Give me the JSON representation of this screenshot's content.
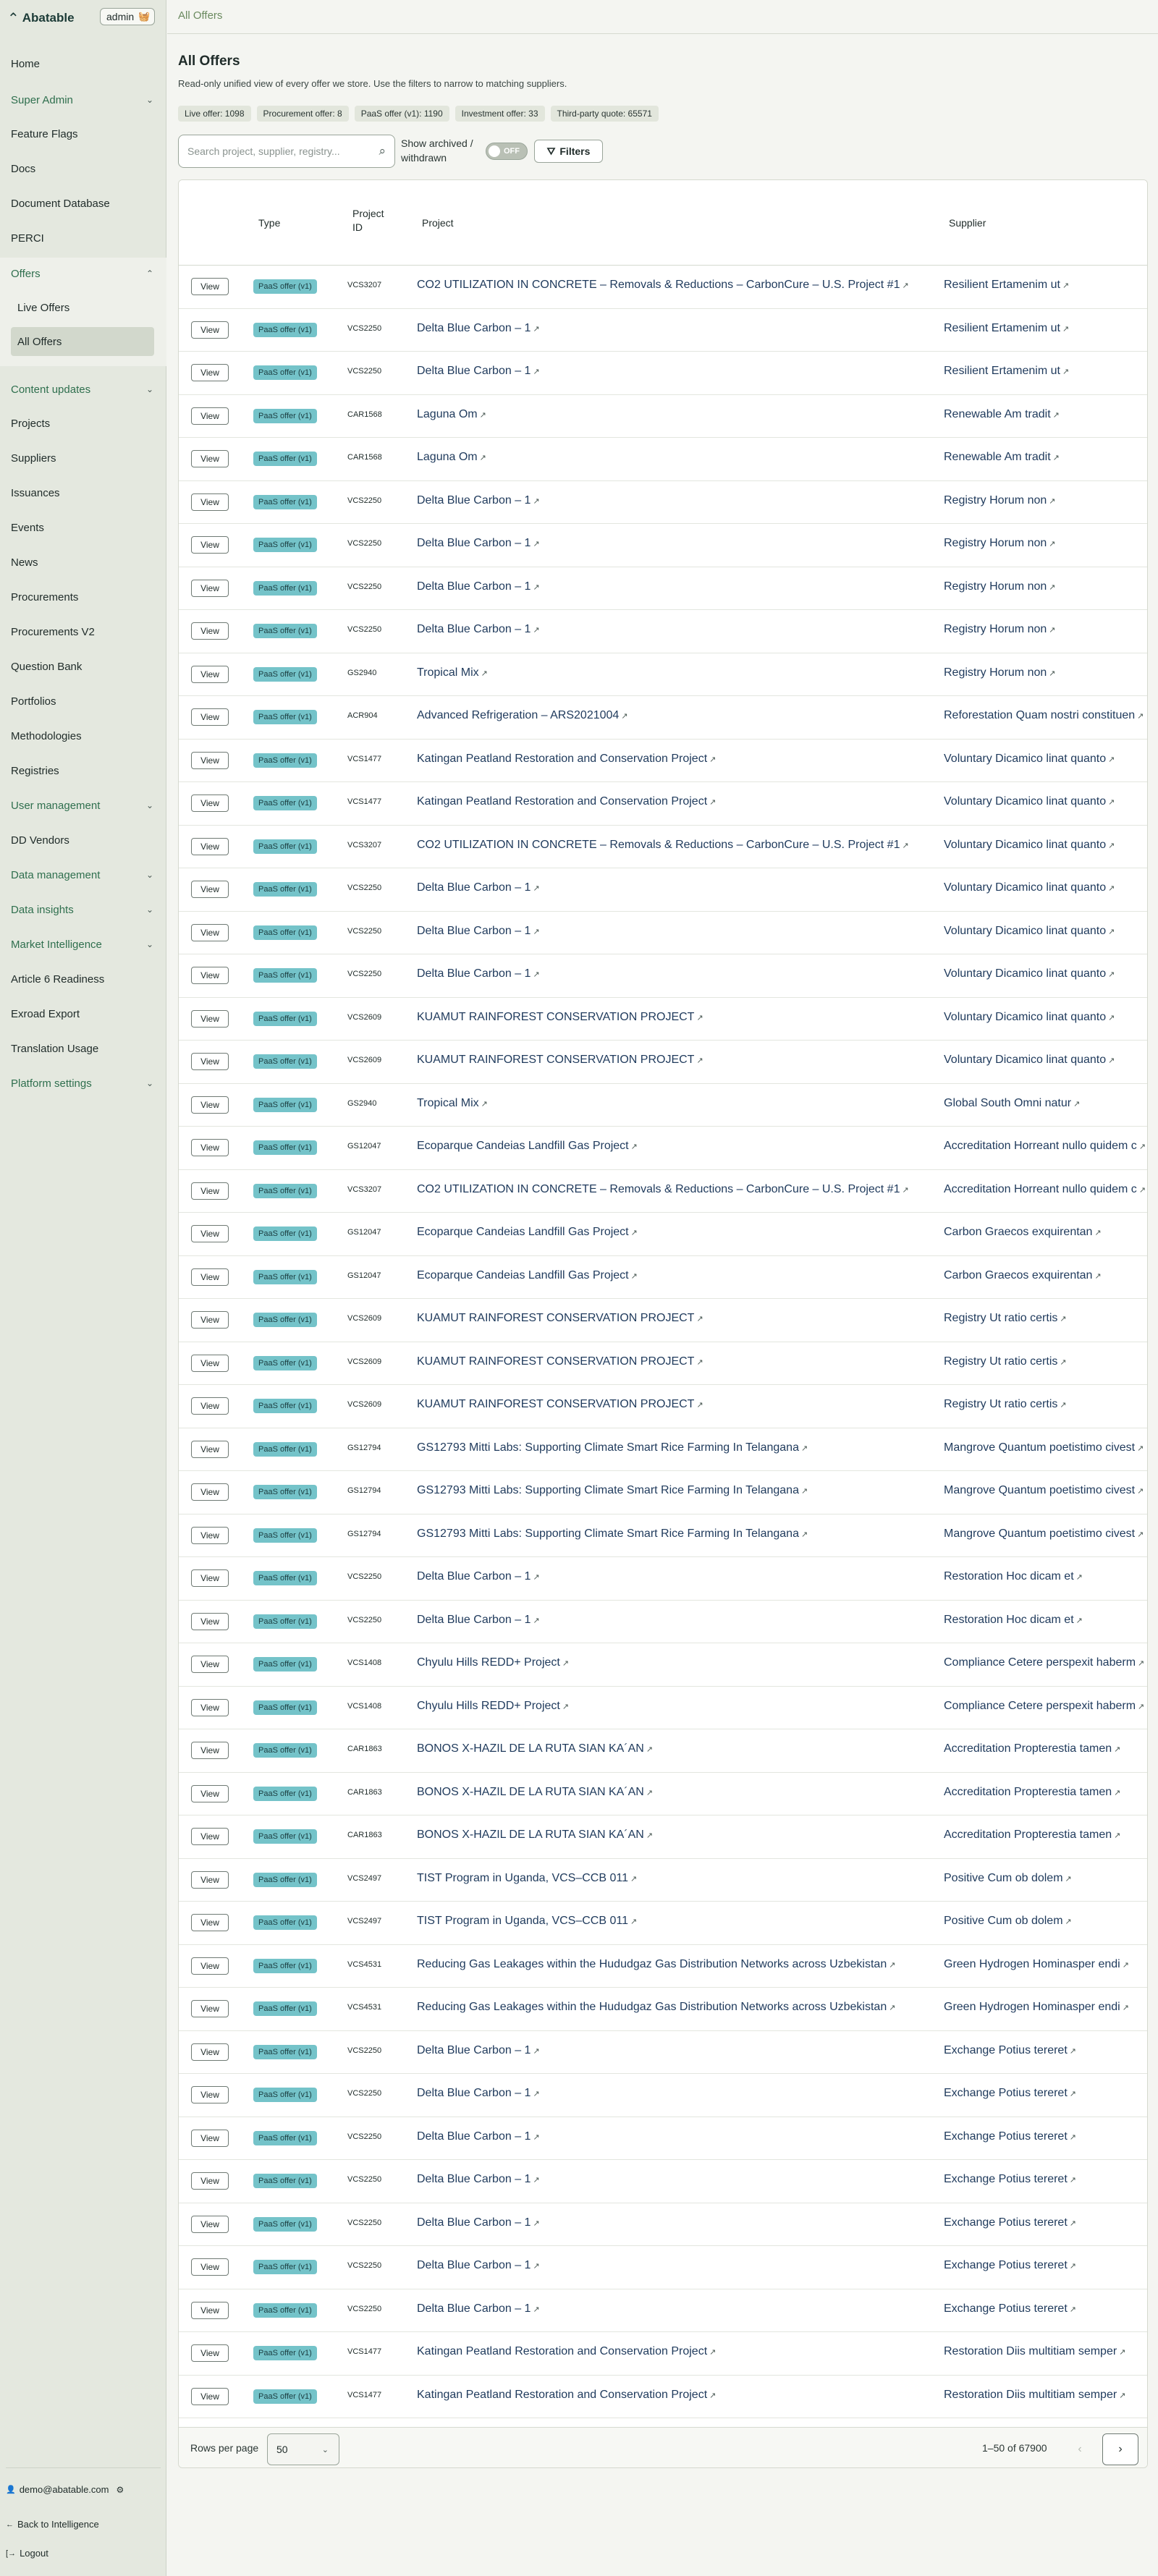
{
  "app": {
    "brand": "Abatable",
    "role": "admin"
  },
  "breadcrumb": "All Offers",
  "sidebar": {
    "items": [
      {
        "label": "Home"
      },
      {
        "label": "Super Admin",
        "chevron": "chevron-down"
      },
      {
        "label": "Feature Flags"
      },
      {
        "label": "Docs"
      },
      {
        "label": "Document Database"
      },
      {
        "label": "PERCI"
      },
      {
        "label": "Offers",
        "chevron": "chevron-up"
      },
      {
        "label": "Content updates",
        "chevron": "chevron-down"
      },
      {
        "label": "Projects"
      },
      {
        "label": "Suppliers"
      },
      {
        "label": "Issuances"
      },
      {
        "label": "Events"
      },
      {
        "label": "News"
      },
      {
        "label": "Procurements"
      },
      {
        "label": "Procurements V2"
      },
      {
        "label": "Question Bank"
      },
      {
        "label": "Portfolios"
      },
      {
        "label": "Methodologies"
      },
      {
        "label": "Registries"
      },
      {
        "label": "User management",
        "chevron": "chevron-down"
      },
      {
        "label": "DD Vendors"
      },
      {
        "label": "Data management",
        "chevron": "chevron-down"
      },
      {
        "label": "Data insights",
        "chevron": "chevron-down"
      },
      {
        "label": "Market Intelligence",
        "chevron": "chevron-down"
      },
      {
        "label": "Article 6 Readiness"
      },
      {
        "label": "Exroad Export"
      },
      {
        "label": "Translation Usage"
      },
      {
        "label": "Platform settings",
        "chevron": "chevron-down"
      }
    ],
    "offers_sub": [
      {
        "label": "Live Offers"
      },
      {
        "label": "All Offers"
      }
    ],
    "footer": {
      "email": "demo@abatable.com",
      "back": "Back to Intelligence",
      "logout": "Logout"
    }
  },
  "page": {
    "title": "All Offers",
    "description": "Read-only unified view of every offer we store. Use the filters to narrow to matching suppliers.",
    "stats": [
      {
        "label": "Live offer: 1098"
      },
      {
        "label": "Procurement offer: 8"
      },
      {
        "label": "PaaS offer (v1): 1190"
      },
      {
        "label": "Investment offer: 33"
      },
      {
        "label": "Third-party quote: 65571"
      }
    ],
    "search_placeholder": "Search project, supplier, registry...",
    "archived_label": "Show archived / withdrawn",
    "toggle_state": "OFF",
    "filters_label": "Filters"
  },
  "table": {
    "columns": {
      "type": "Type",
      "project_id": "Project ID",
      "project": "Project",
      "supplier": "Supplier"
    },
    "view_label": "View",
    "rows": [
      {
        "type": "PaaS offer (v1)",
        "id": "VCS3207",
        "project": "CO2 UTILIZATION IN CONCRETE – Removals & Reductions – CarbonCure – U.S. Project #1",
        "supplier": "Resilient Ertamenim ut"
      },
      {
        "type": "PaaS offer (v1)",
        "id": "VCS2250",
        "project": "Delta Blue Carbon – 1",
        "supplier": "Resilient Ertamenim ut"
      },
      {
        "type": "PaaS offer (v1)",
        "id": "VCS2250",
        "project": "Delta Blue Carbon – 1",
        "supplier": "Resilient Ertamenim ut"
      },
      {
        "type": "PaaS offer (v1)",
        "id": "CAR1568",
        "project": "Laguna Om",
        "supplier": "Renewable Am tradit"
      },
      {
        "type": "PaaS offer (v1)",
        "id": "CAR1568",
        "project": "Laguna Om",
        "supplier": "Renewable Am tradit"
      },
      {
        "type": "PaaS offer (v1)",
        "id": "VCS2250",
        "project": "Delta Blue Carbon – 1",
        "supplier": "Registry Horum non"
      },
      {
        "type": "PaaS offer (v1)",
        "id": "VCS2250",
        "project": "Delta Blue Carbon – 1",
        "supplier": "Registry Horum non"
      },
      {
        "type": "PaaS offer (v1)",
        "id": "VCS2250",
        "project": "Delta Blue Carbon – 1",
        "supplier": "Registry Horum non"
      },
      {
        "type": "PaaS offer (v1)",
        "id": "VCS2250",
        "project": "Delta Blue Carbon – 1",
        "supplier": "Registry Horum non"
      },
      {
        "type": "PaaS offer (v1)",
        "id": "GS2940",
        "project": "Tropical Mix",
        "supplier": "Registry Horum non"
      },
      {
        "type": "PaaS offer (v1)",
        "id": "ACR904",
        "project": "Advanced Refrigeration – ARS2021004",
        "supplier": "Reforestation Quam nostri constituen"
      },
      {
        "type": "PaaS offer (v1)",
        "id": "VCS1477",
        "project": "Katingan Peatland Restoration and Conservation Project",
        "supplier": "Voluntary Dicamico linat quanto"
      },
      {
        "type": "PaaS offer (v1)",
        "id": "VCS1477",
        "project": "Katingan Peatland Restoration and Conservation Project",
        "supplier": "Voluntary Dicamico linat quanto"
      },
      {
        "type": "PaaS offer (v1)",
        "id": "VCS3207",
        "project": "CO2 UTILIZATION IN CONCRETE – Removals & Reductions – CarbonCure – U.S. Project #1",
        "supplier": "Voluntary Dicamico linat quanto"
      },
      {
        "type": "PaaS offer (v1)",
        "id": "VCS2250",
        "project": "Delta Blue Carbon – 1",
        "supplier": "Voluntary Dicamico linat quanto"
      },
      {
        "type": "PaaS offer (v1)",
        "id": "VCS2250",
        "project": "Delta Blue Carbon – 1",
        "supplier": "Voluntary Dicamico linat quanto"
      },
      {
        "type": "PaaS offer (v1)",
        "id": "VCS2250",
        "project": "Delta Blue Carbon – 1",
        "supplier": "Voluntary Dicamico linat quanto"
      },
      {
        "type": "PaaS offer (v1)",
        "id": "VCS2609",
        "project": "KUAMUT RAINFOREST CONSERVATION PROJECT",
        "supplier": "Voluntary Dicamico linat quanto"
      },
      {
        "type": "PaaS offer (v1)",
        "id": "VCS2609",
        "project": "KUAMUT RAINFOREST CONSERVATION PROJECT",
        "supplier": "Voluntary Dicamico linat quanto"
      },
      {
        "type": "PaaS offer (v1)",
        "id": "GS2940",
        "project": "Tropical Mix",
        "supplier": "Global South Omni natur"
      },
      {
        "type": "PaaS offer (v1)",
        "id": "GS12047",
        "project": "Ecoparque Candeias Landfill Gas Project",
        "supplier": "Accreditation Horreant nullo quidem c"
      },
      {
        "type": "PaaS offer (v1)",
        "id": "VCS3207",
        "project": "CO2 UTILIZATION IN CONCRETE – Removals & Reductions – CarbonCure – U.S. Project #1",
        "supplier": "Accreditation Horreant nullo quidem c"
      },
      {
        "type": "PaaS offer (v1)",
        "id": "GS12047",
        "project": "Ecoparque Candeias Landfill Gas Project",
        "supplier": "Carbon Graecos exquirentan"
      },
      {
        "type": "PaaS offer (v1)",
        "id": "GS12047",
        "project": "Ecoparque Candeias Landfill Gas Project",
        "supplier": "Carbon Graecos exquirentan"
      },
      {
        "type": "PaaS offer (v1)",
        "id": "VCS2609",
        "project": "KUAMUT RAINFOREST CONSERVATION PROJECT",
        "supplier": "Registry Ut ratio certis"
      },
      {
        "type": "PaaS offer (v1)",
        "id": "VCS2609",
        "project": "KUAMUT RAINFOREST CONSERVATION PROJECT",
        "supplier": "Registry Ut ratio certis"
      },
      {
        "type": "PaaS offer (v1)",
        "id": "VCS2609",
        "project": "KUAMUT RAINFOREST CONSERVATION PROJECT",
        "supplier": "Registry Ut ratio certis"
      },
      {
        "type": "PaaS offer (v1)",
        "id": "GS12794",
        "project": "GS12793 Mitti Labs: Supporting Climate Smart Rice Farming In Telangana",
        "supplier": "Mangrove Quantum poetistimo civest"
      },
      {
        "type": "PaaS offer (v1)",
        "id": "GS12794",
        "project": "GS12793 Mitti Labs: Supporting Climate Smart Rice Farming In Telangana",
        "supplier": "Mangrove Quantum poetistimo civest"
      },
      {
        "type": "PaaS offer (v1)",
        "id": "GS12794",
        "project": "GS12793 Mitti Labs: Supporting Climate Smart Rice Farming In Telangana",
        "supplier": "Mangrove Quantum poetistimo civest"
      },
      {
        "type": "PaaS offer (v1)",
        "id": "VCS2250",
        "project": "Delta Blue Carbon – 1",
        "supplier": "Restoration Hoc dicam et"
      },
      {
        "type": "PaaS offer (v1)",
        "id": "VCS2250",
        "project": "Delta Blue Carbon – 1",
        "supplier": "Restoration Hoc dicam et"
      },
      {
        "type": "PaaS offer (v1)",
        "id": "VCS1408",
        "project": "Chyulu Hills REDD+ Project",
        "supplier": "Compliance Cetere perspexit haberm"
      },
      {
        "type": "PaaS offer (v1)",
        "id": "VCS1408",
        "project": "Chyulu Hills REDD+ Project",
        "supplier": "Compliance Cetere perspexit haberm"
      },
      {
        "type": "PaaS offer (v1)",
        "id": "CAR1863",
        "project": "BONOS X-HAZIL DE LA RUTA SIAN KA´AN",
        "supplier": "Accreditation Propterestia tamen"
      },
      {
        "type": "PaaS offer (v1)",
        "id": "CAR1863",
        "project": "BONOS X-HAZIL DE LA RUTA SIAN KA´AN",
        "supplier": "Accreditation Propterestia tamen"
      },
      {
        "type": "PaaS offer (v1)",
        "id": "CAR1863",
        "project": "BONOS X-HAZIL DE LA RUTA SIAN KA´AN",
        "supplier": "Accreditation Propterestia tamen"
      },
      {
        "type": "PaaS offer (v1)",
        "id": "VCS2497",
        "project": "TIST Program in Uganda, VCS–CCB 011",
        "supplier": "Positive Cum ob dolem"
      },
      {
        "type": "PaaS offer (v1)",
        "id": "VCS2497",
        "project": "TIST Program in Uganda, VCS–CCB 011",
        "supplier": "Positive Cum ob dolem"
      },
      {
        "type": "PaaS offer (v1)",
        "id": "VCS4531",
        "project": "Reducing Gas Leakages within the Hududgaz Gas Distribution Networks across Uzbekistan",
        "supplier": "Green Hydrogen Hominasper endi"
      },
      {
        "type": "PaaS offer (v1)",
        "id": "VCS4531",
        "project": "Reducing Gas Leakages within the Hududgaz Gas Distribution Networks across Uzbekistan",
        "supplier": "Green Hydrogen Hominasper endi"
      },
      {
        "type": "PaaS offer (v1)",
        "id": "VCS2250",
        "project": "Delta Blue Carbon – 1",
        "supplier": "Exchange Potius tereret"
      },
      {
        "type": "PaaS offer (v1)",
        "id": "VCS2250",
        "project": "Delta Blue Carbon – 1",
        "supplier": "Exchange Potius tereret"
      },
      {
        "type": "PaaS offer (v1)",
        "id": "VCS2250",
        "project": "Delta Blue Carbon – 1",
        "supplier": "Exchange Potius tereret"
      },
      {
        "type": "PaaS offer (v1)",
        "id": "VCS2250",
        "project": "Delta Blue Carbon – 1",
        "supplier": "Exchange Potius tereret"
      },
      {
        "type": "PaaS offer (v1)",
        "id": "VCS2250",
        "project": "Delta Blue Carbon – 1",
        "supplier": "Exchange Potius tereret"
      },
      {
        "type": "PaaS offer (v1)",
        "id": "VCS2250",
        "project": "Delta Blue Carbon – 1",
        "supplier": "Exchange Potius tereret"
      },
      {
        "type": "PaaS offer (v1)",
        "id": "VCS2250",
        "project": "Delta Blue Carbon – 1",
        "supplier": "Exchange Potius tereret"
      },
      {
        "type": "PaaS offer (v1)",
        "id": "VCS1477",
        "project": "Katingan Peatland Restoration and Conservation Project",
        "supplier": "Restoration Diis multitiam semper"
      },
      {
        "type": "PaaS offer (v1)",
        "id": "VCS1477",
        "project": "Katingan Peatland Restoration and Conservation Project",
        "supplier": "Restoration Diis multitiam semper"
      }
    ]
  },
  "pagination": {
    "rows_per_page_label": "Rows per page",
    "rows_per_page": "50",
    "range": "1–50 of 67900"
  }
}
